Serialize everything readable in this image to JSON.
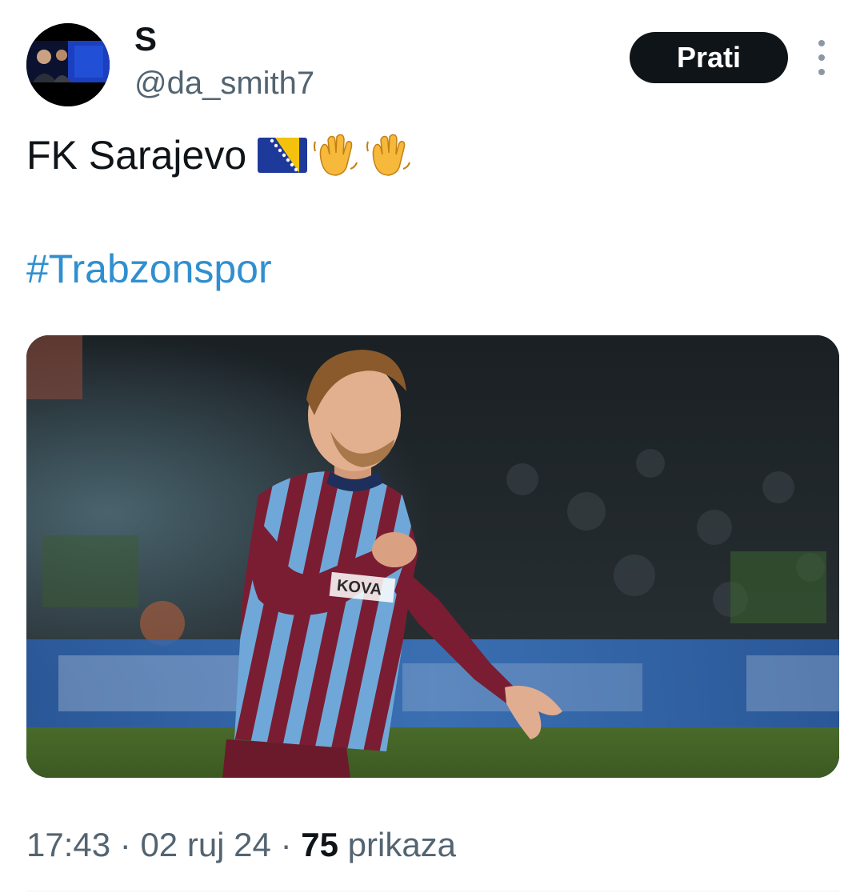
{
  "author": {
    "display_name": "S",
    "handle": "@da_smith7",
    "avatar_icon": "profile-photo"
  },
  "follow_button": {
    "label": "Prati"
  },
  "more_menu": {
    "icon": "more-vertical-icon"
  },
  "tweet": {
    "text": "FK Sarajevo",
    "emojis": [
      "flag-bosnia-icon",
      "waving-hand-icon",
      "waving-hand-icon"
    ],
    "hashtag": "#Trabzonspor"
  },
  "media": {
    "kind": "photo",
    "subject": "football player in maroon and blue striped kit",
    "kit_text": "KOVA"
  },
  "meta": {
    "time": "17:43",
    "separator": "·",
    "date": "02 ruj 24",
    "views_count": "75",
    "views_label": "prikaza"
  },
  "colors": {
    "hashtag": "#2f8fd0",
    "follow_button_bg": "#0f1419",
    "secondary_text": "#536471"
  }
}
